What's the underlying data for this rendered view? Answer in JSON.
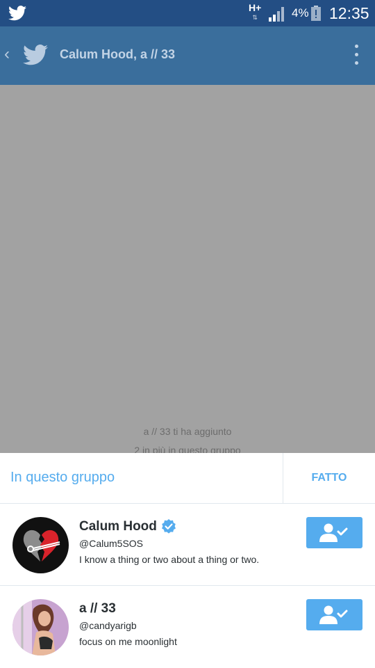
{
  "status_bar": {
    "network": "H+",
    "battery_percent": "4%",
    "time": "12:35",
    "icons": [
      "twitter-bird-icon",
      "network-arrows-icon",
      "signal-icon",
      "battery-low-icon"
    ]
  },
  "app_bar": {
    "title": "Calum Hood, a // 33",
    "icons": [
      "back-chevron-icon",
      "twitter-logo-icon",
      "overflow-menu-icon"
    ]
  },
  "conversation": {
    "added_notice": "a // 33 ti ha aggiunto",
    "members_notice": "2 in più in questo gruppo"
  },
  "group_sheet": {
    "title": "In questo gruppo",
    "done_label": "FATTO",
    "members": [
      {
        "name": "Calum Hood",
        "verified": true,
        "handle": "@Calum5SOS",
        "bio": "I know a thing or two about a thing or two.",
        "following": true
      },
      {
        "name": "a // 33",
        "verified": false,
        "handle": "@candyarigb",
        "bio": "focus on me moonlight",
        "following": true
      }
    ]
  },
  "colors": {
    "status_bar": "#234e84",
    "app_bar": "#3a6e9c",
    "accent": "#55acee",
    "dim_overlay": "#a2a2a2"
  }
}
